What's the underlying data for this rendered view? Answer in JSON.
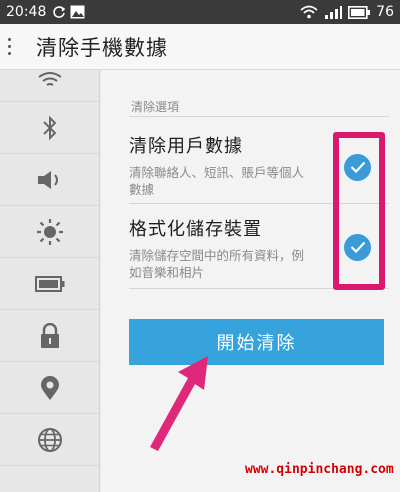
{
  "status_bar": {
    "time": "20:48",
    "battery": "76",
    "icons": [
      "sync-icon",
      "image-icon",
      "wifi-icon",
      "signal-icon",
      "battery-icon"
    ]
  },
  "header": {
    "title": "清除手機數據"
  },
  "sidebar": {
    "items": [
      {
        "icon": "wifi-icon"
      },
      {
        "icon": "bluetooth-icon"
      },
      {
        "icon": "volume-icon"
      },
      {
        "icon": "brightness-icon"
      },
      {
        "icon": "battery-icon"
      },
      {
        "icon": "lock-icon"
      },
      {
        "icon": "location-icon"
      },
      {
        "icon": "globe-icon"
      }
    ]
  },
  "main": {
    "section_label": "清除選項",
    "options": [
      {
        "title": "清除用戶數據",
        "desc": "清除聯絡人、短訊、賬戶等個人數據",
        "checked": true
      },
      {
        "title": "格式化儲存裝置",
        "desc": "清除儲存空間中的所有資料，例如音樂和相片",
        "checked": true
      }
    ],
    "start_button": "開始清除"
  },
  "colors": {
    "accent": "#37a3dc",
    "highlight": "#d8196e"
  },
  "watermark": "www.qinpinchang.com"
}
